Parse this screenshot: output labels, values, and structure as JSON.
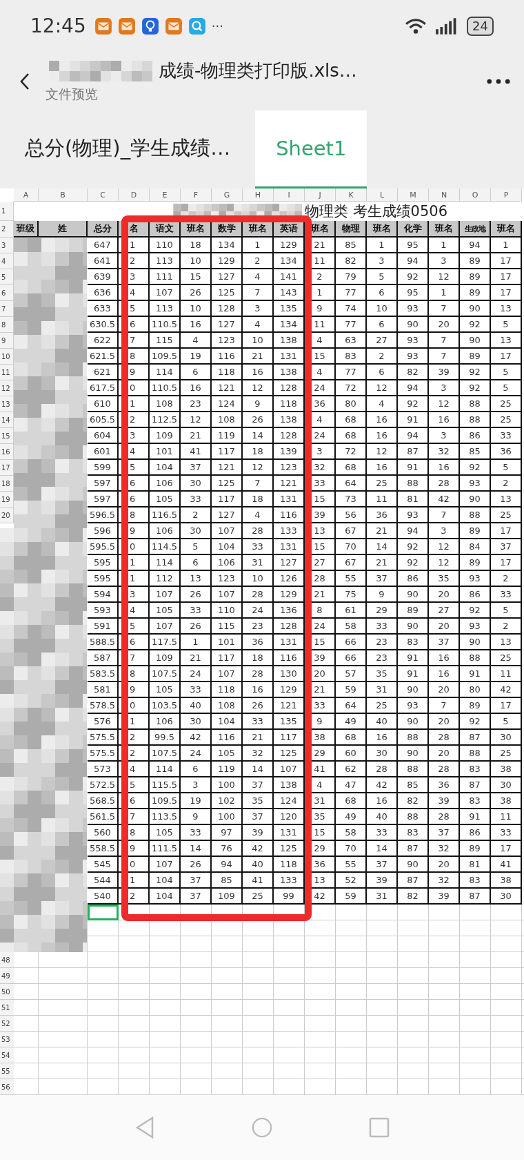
{
  "status_bar": {
    "time": "12:45",
    "more": "···",
    "battery": "24"
  },
  "header": {
    "title": "成绩-物理类打印版.xls…",
    "subtitle": "文件预览"
  },
  "tabs": [
    {
      "label": "总分(物理)_学生成绩…",
      "selected": false
    },
    {
      "label": "Sheet1",
      "selected": true
    }
  ],
  "sheet": {
    "columns": [
      "A",
      "B",
      "C",
      "D",
      "E",
      "F",
      "G",
      "H",
      "I",
      "J",
      "K",
      "L",
      "M",
      "N",
      "O",
      "P"
    ],
    "title_row": {
      "n": "1",
      "text": "物理类 考生成绩0506"
    },
    "header_row": {
      "n": "2",
      "cells": [
        "班级",
        "姓",
        "总分",
        "名",
        "语文",
        "班名",
        "数学",
        "班名",
        "英语",
        "班名",
        "物理",
        "班名",
        "化学",
        "班名",
        "生政地",
        "班名"
      ]
    },
    "rows": [
      {
        "n": "3",
        "cells": [
          "",
          "",
          "647",
          "1",
          "110",
          "18",
          "134",
          "1",
          "129",
          "21",
          "85",
          "1",
          "95",
          "1",
          "94",
          "1"
        ]
      },
      {
        "n": "4",
        "cells": [
          "",
          "",
          "641",
          "2",
          "113",
          "10",
          "129",
          "2",
          "134",
          "11",
          "82",
          "3",
          "94",
          "3",
          "89",
          "17"
        ]
      },
      {
        "n": "5",
        "cells": [
          "",
          "",
          "639",
          "3",
          "111",
          "15",
          "127",
          "4",
          "141",
          "2",
          "79",
          "5",
          "92",
          "12",
          "89",
          "17"
        ]
      },
      {
        "n": "6",
        "cells": [
          "",
          "",
          "636",
          "4",
          "107",
          "26",
          "125",
          "7",
          "143",
          "1",
          "77",
          "6",
          "95",
          "1",
          "89",
          "17"
        ]
      },
      {
        "n": "7",
        "cells": [
          "",
          "",
          "633",
          "5",
          "113",
          "10",
          "128",
          "3",
          "135",
          "9",
          "74",
          "10",
          "93",
          "7",
          "90",
          "13"
        ]
      },
      {
        "n": "8",
        "cells": [
          "",
          "",
          "630.5",
          "6",
          "110.5",
          "16",
          "127",
          "4",
          "134",
          "11",
          "77",
          "6",
          "90",
          "20",
          "92",
          "5"
        ]
      },
      {
        "n": "9",
        "cells": [
          "",
          "",
          "622",
          "7",
          "115",
          "4",
          "123",
          "10",
          "138",
          "4",
          "63",
          "27",
          "93",
          "7",
          "90",
          "13"
        ]
      },
      {
        "n": "10",
        "cells": [
          "",
          "",
          "621.5",
          "8",
          "109.5",
          "19",
          "116",
          "21",
          "131",
          "15",
          "83",
          "2",
          "93",
          "7",
          "89",
          "17"
        ]
      },
      {
        "n": "11",
        "cells": [
          "",
          "",
          "621",
          "9",
          "114",
          "6",
          "118",
          "16",
          "138",
          "4",
          "77",
          "6",
          "82",
          "39",
          "92",
          "5"
        ]
      },
      {
        "n": "12",
        "cells": [
          "",
          "",
          "617.5",
          "0",
          "110.5",
          "16",
          "121",
          "12",
          "128",
          "24",
          "72",
          "12",
          "94",
          "3",
          "92",
          "5"
        ]
      },
      {
        "n": "13",
        "cells": [
          "",
          "",
          "610",
          "1",
          "108",
          "23",
          "124",
          "9",
          "118",
          "36",
          "80",
          "4",
          "92",
          "12",
          "88",
          "25"
        ]
      },
      {
        "n": "14",
        "cells": [
          "",
          "",
          "605.5",
          "2",
          "112.5",
          "12",
          "108",
          "26",
          "138",
          "4",
          "68",
          "16",
          "91",
          "16",
          "88",
          "25"
        ]
      },
      {
        "n": "15",
        "cells": [
          "",
          "",
          "604",
          "3",
          "109",
          "21",
          "119",
          "14",
          "128",
          "24",
          "68",
          "16",
          "94",
          "3",
          "86",
          "33"
        ]
      },
      {
        "n": "16",
        "cells": [
          "",
          "",
          "601",
          "4",
          "101",
          "41",
          "117",
          "18",
          "139",
          "3",
          "72",
          "12",
          "87",
          "32",
          "85",
          "36"
        ]
      },
      {
        "n": "17",
        "cells": [
          "",
          "",
          "599",
          "5",
          "104",
          "37",
          "121",
          "12",
          "123",
          "32",
          "68",
          "16",
          "91",
          "16",
          "92",
          "5"
        ]
      },
      {
        "n": "18",
        "cells": [
          "",
          "",
          "597",
          "6",
          "106",
          "30",
          "125",
          "7",
          "121",
          "33",
          "64",
          "25",
          "88",
          "28",
          "93",
          "2"
        ]
      },
      {
        "n": "19",
        "cells": [
          "",
          "",
          "597",
          "6",
          "105",
          "33",
          "117",
          "18",
          "131",
          "15",
          "73",
          "11",
          "81",
          "42",
          "90",
          "13"
        ]
      },
      {
        "n": "20",
        "cells": [
          "",
          "",
          "596.5",
          "8",
          "116.5",
          "2",
          "127",
          "4",
          "116",
          "39",
          "56",
          "36",
          "93",
          "7",
          "88",
          "25"
        ]
      },
      {
        "cells": [
          "",
          "",
          "596",
          "9",
          "106",
          "30",
          "107",
          "28",
          "133",
          "13",
          "67",
          "21",
          "94",
          "3",
          "89",
          "17"
        ]
      },
      {
        "cells": [
          "",
          "",
          "595.5",
          "0",
          "114.5",
          "5",
          "104",
          "33",
          "131",
          "15",
          "70",
          "14",
          "92",
          "12",
          "84",
          "37"
        ]
      },
      {
        "cells": [
          "",
          "",
          "595",
          "1",
          "114",
          "6",
          "106",
          "31",
          "127",
          "27",
          "67",
          "21",
          "92",
          "12",
          "89",
          "17"
        ]
      },
      {
        "cells": [
          "",
          "",
          "595",
          "1",
          "112",
          "13",
          "123",
          "10",
          "126",
          "28",
          "55",
          "37",
          "86",
          "35",
          "93",
          "2"
        ]
      },
      {
        "cells": [
          "",
          "",
          "594",
          "3",
          "107",
          "26",
          "107",
          "28",
          "129",
          "21",
          "75",
          "9",
          "90",
          "20",
          "86",
          "33"
        ]
      },
      {
        "cells": [
          "",
          "",
          "593",
          "4",
          "105",
          "33",
          "110",
          "24",
          "136",
          "8",
          "61",
          "29",
          "89",
          "27",
          "92",
          "5"
        ]
      },
      {
        "cells": [
          "",
          "",
          "591",
          "5",
          "107",
          "26",
          "115",
          "23",
          "128",
          "24",
          "58",
          "33",
          "90",
          "20",
          "93",
          "2"
        ]
      },
      {
        "cells": [
          "",
          "",
          "588.5",
          "6",
          "117.5",
          "1",
          "101",
          "36",
          "131",
          "15",
          "66",
          "23",
          "83",
          "37",
          "90",
          "13"
        ]
      },
      {
        "cells": [
          "",
          "",
          "587",
          "7",
          "109",
          "21",
          "117",
          "18",
          "116",
          "39",
          "66",
          "23",
          "91",
          "16",
          "88",
          "25"
        ]
      },
      {
        "cells": [
          "",
          "",
          "583.5",
          "8",
          "107.5",
          "24",
          "107",
          "28",
          "130",
          "20",
          "57",
          "35",
          "91",
          "16",
          "91",
          "11"
        ]
      },
      {
        "cells": [
          "",
          "",
          "581",
          "9",
          "105",
          "33",
          "118",
          "16",
          "129",
          "21",
          "59",
          "31",
          "90",
          "20",
          "80",
          "42"
        ]
      },
      {
        "cells": [
          "",
          "",
          "578.5",
          "0",
          "103.5",
          "40",
          "108",
          "26",
          "121",
          "33",
          "64",
          "25",
          "93",
          "7",
          "89",
          "17"
        ]
      },
      {
        "cells": [
          "",
          "",
          "576",
          "1",
          "106",
          "30",
          "104",
          "33",
          "135",
          "9",
          "49",
          "40",
          "90",
          "20",
          "92",
          "5"
        ]
      },
      {
        "cells": [
          "",
          "",
          "575.5",
          "2",
          "99.5",
          "42",
          "116",
          "21",
          "117",
          "38",
          "68",
          "16",
          "88",
          "28",
          "87",
          "30"
        ]
      },
      {
        "cells": [
          "",
          "",
          "575.5",
          "2",
          "107.5",
          "24",
          "105",
          "32",
          "125",
          "29",
          "60",
          "30",
          "90",
          "20",
          "88",
          "25"
        ]
      },
      {
        "cells": [
          "",
          "",
          "573",
          "4",
          "114",
          "6",
          "119",
          "14",
          "107",
          "41",
          "62",
          "28",
          "88",
          "28",
          "83",
          "38"
        ]
      },
      {
        "cells": [
          "",
          "",
          "572.5",
          "5",
          "115.5",
          "3",
          "100",
          "37",
          "138",
          "4",
          "47",
          "42",
          "85",
          "36",
          "87",
          "30"
        ]
      },
      {
        "cells": [
          "",
          "",
          "568.5",
          "6",
          "109.5",
          "19",
          "102",
          "35",
          "124",
          "31",
          "68",
          "16",
          "82",
          "39",
          "83",
          "38"
        ]
      },
      {
        "cells": [
          "",
          "",
          "561.5",
          "7",
          "113.5",
          "9",
          "100",
          "37",
          "120",
          "35",
          "49",
          "40",
          "88",
          "28",
          "91",
          "11"
        ]
      },
      {
        "cells": [
          "",
          "",
          "560",
          "8",
          "105",
          "33",
          "97",
          "39",
          "131",
          "15",
          "58",
          "33",
          "83",
          "37",
          "86",
          "33"
        ]
      },
      {
        "cells": [
          "",
          "",
          "558.5",
          "9",
          "111.5",
          "14",
          "76",
          "42",
          "125",
          "29",
          "70",
          "14",
          "87",
          "32",
          "89",
          "17"
        ]
      },
      {
        "cells": [
          "",
          "",
          "545",
          "0",
          "107",
          "26",
          "94",
          "40",
          "118",
          "36",
          "55",
          "37",
          "90",
          "20",
          "81",
          "41"
        ]
      },
      {
        "cells": [
          "",
          "",
          "544",
          "1",
          "104",
          "37",
          "85",
          "41",
          "133",
          "13",
          "52",
          "39",
          "87",
          "32",
          "83",
          "38"
        ]
      },
      {
        "cells": [
          "",
          "",
          "540",
          "2",
          "104",
          "37",
          "109",
          "25",
          "99",
          "42",
          "59",
          "31",
          "82",
          "39",
          "87",
          "30"
        ]
      }
    ],
    "empty_rows": [
      {
        "selected": true
      },
      {
        "selected": false
      },
      {
        "selected": false
      },
      {
        "n": "48",
        "selected": false
      },
      {
        "n": "49",
        "selected": false
      },
      {
        "n": "50",
        "selected": false
      },
      {
        "n": "51",
        "selected": false
      },
      {
        "n": "52",
        "selected": false
      },
      {
        "n": "53",
        "selected": false
      },
      {
        "n": "54",
        "selected": false
      },
      {
        "n": "55",
        "selected": false
      },
      {
        "n": "56",
        "selected": false
      }
    ]
  }
}
